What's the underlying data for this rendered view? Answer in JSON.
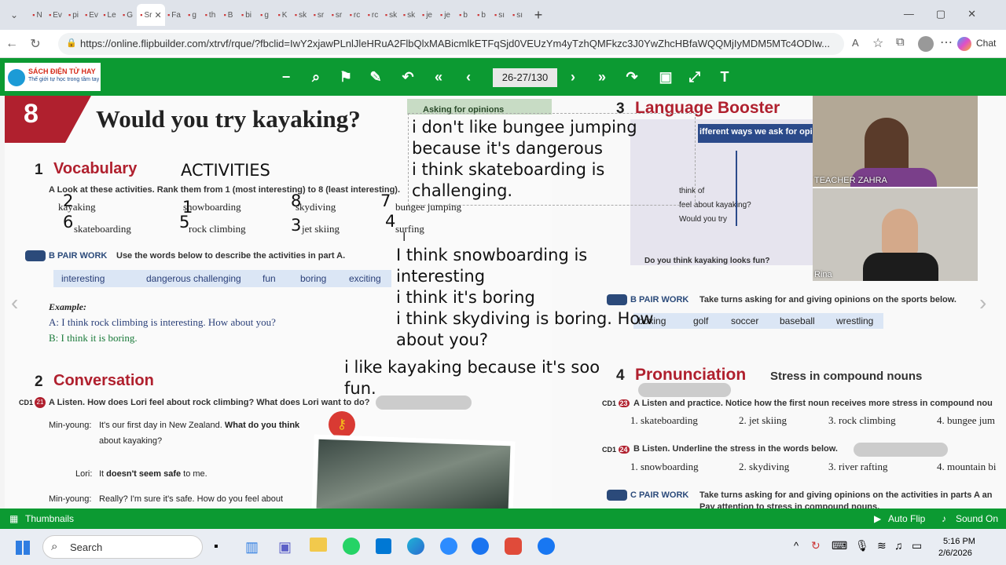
{
  "browser": {
    "tabs": [
      "N",
      "Ev",
      "pi",
      "Ev",
      "Le",
      "G",
      "Sr",
      "Fa",
      "g",
      "th",
      "B",
      "bi",
      "g",
      "K",
      "sk",
      "sr",
      "sr",
      "rc",
      "rc",
      "sk",
      "sk",
      "je",
      "je",
      "b",
      "b",
      "sı",
      "sı"
    ],
    "new_tab_icon": "+",
    "url": "https://online.flipbuilder.com/xtrvf/rque/?fbclid=IwY2xjawPLnlJleHRuA2FlbQlxMABicmlkETFqSjd0VEUzYm4yTzhQMFkzc3J0YwZhcHBfaWQQMjIyMDM5MTc4ODIw...",
    "chat_label": "Chat"
  },
  "flipbook": {
    "logo_title": "SÁCH ĐIỆN TỬ HAY",
    "logo_subtitle": "Thế giới tự học trong tầm tay",
    "page_indicator": "26-27/130",
    "thumbnails_label": "Thumbnails",
    "autoflip_label": "Auto Flip",
    "sound_label": "Sound On"
  },
  "left_page": {
    "unit_number": "8",
    "title": "Would you try kayaking?",
    "section1_num": "1",
    "section1_title": "Vocabulary",
    "activities_note": "ACTIVITIES",
    "instruction_a": "A  Look at these activities. Rank them from 1 (most interesting) to 8 (least interesting).",
    "activities": [
      {
        "rank": "2",
        "label": "kayaking"
      },
      {
        "rank": "6",
        "label": "skateboarding"
      },
      {
        "rank": "1",
        "label": "snowboarding"
      },
      {
        "rank": "5",
        "label": "rock climbing"
      },
      {
        "rank": "8",
        "label": "skydiving"
      },
      {
        "rank": "3",
        "label": "jet skiing"
      },
      {
        "rank": "7",
        "label": "bungee jumping"
      },
      {
        "rank": "4",
        "label": "surfing"
      }
    ],
    "pairwork_b_label": "PAIR WORK",
    "pairwork_b_text": "Use the words below to describe the activities in part A.",
    "describe_words": [
      "interesting",
      "dangerous",
      "challenging",
      "fun",
      "boring",
      "exciting"
    ],
    "example_label": "Example:",
    "example_a": "A: I think rock climbing is interesting. How about you?",
    "example_b": "B: I think it is boring.",
    "section2_num": "2",
    "section2_title": "Conversation",
    "cd_label": "CD1",
    "cd_track": "21",
    "listen_a": "A  Listen. How does Lori feel about rock climbing? What does Lori want to do?",
    "dialog": [
      {
        "speaker": "Min-young:",
        "text": "It's our first day in New Zealand. ",
        "bold": "What do you think",
        "cont": "about kayaking?"
      },
      {
        "speaker": "Lori:",
        "text": "It ",
        "bold": "doesn't seem safe",
        "cont": " to me."
      },
      {
        "speaker": "Min-young:",
        "text": "Really? I'm sure it's safe. How do you feel about",
        "bold": "",
        "cont": ""
      }
    ],
    "asking_box_title": "Asking for opinions"
  },
  "notes": {
    "textbox_lines": [
      "i don't like bungee jumping",
      "because it's dangerous",
      "i think skateboarding is",
      "challenging."
    ],
    "middle_lines": [
      "I think snowboarding is",
      "interesting",
      "i think it's boring",
      "i think skydiving is boring. How",
      "about you?"
    ],
    "bottom_lines": [
      "i like kayaking because it's soo",
      "fun."
    ]
  },
  "right_page": {
    "section3_num": "3",
    "section3_title": "Language Booster",
    "booster_text": "ifferent ways we ask for opi",
    "booster_rows": [
      "think of",
      "feel about   kayaking?",
      "Would you try"
    ],
    "booster_caption": "Do you think kayaking looks fun?",
    "pairwork_b_label": "PAIR WORK",
    "pairwork_b_text": "Take turns asking for and giving opinions on the sports below.",
    "sports": [
      "boxing",
      "golf",
      "soccer",
      "baseball",
      "wrestling"
    ],
    "section4_num": "4",
    "section4_title": "Pronunciation",
    "section4_sub": "Stress in compound nouns",
    "listen_a": "A  Listen and practice. Notice how the first noun receives more stress in compound nou",
    "listen_a_items": [
      "1. skateboarding",
      "2. jet skiing",
      "3. rock climbing",
      "4. bungee jum"
    ],
    "listen_b": "B  Listen. Underline the stress in the words below.",
    "listen_b_items": [
      "1. snowboarding",
      "2. skydiving",
      "3. river rafting",
      "4. mountain bi"
    ],
    "pairwork_c_label": "PAIR WORK",
    "pairwork_c_text": "Take turns asking for and giving opinions on the activities in parts A an",
    "pairwork_c_sub": "Pay attention to stress in compound nouns.",
    "cd_a": "23",
    "cd_b": "24"
  },
  "video": {
    "teacher_name": "TEACHER ZAHRA",
    "student_name": "Rina"
  },
  "taskbar": {
    "search_label": "Search",
    "time": "5:16 PM",
    "date": "2/6/2026"
  },
  "colors": {
    "flip_green": "#0c9a32",
    "title_red": "#b0202e",
    "taskbar": "#e9edf3"
  }
}
